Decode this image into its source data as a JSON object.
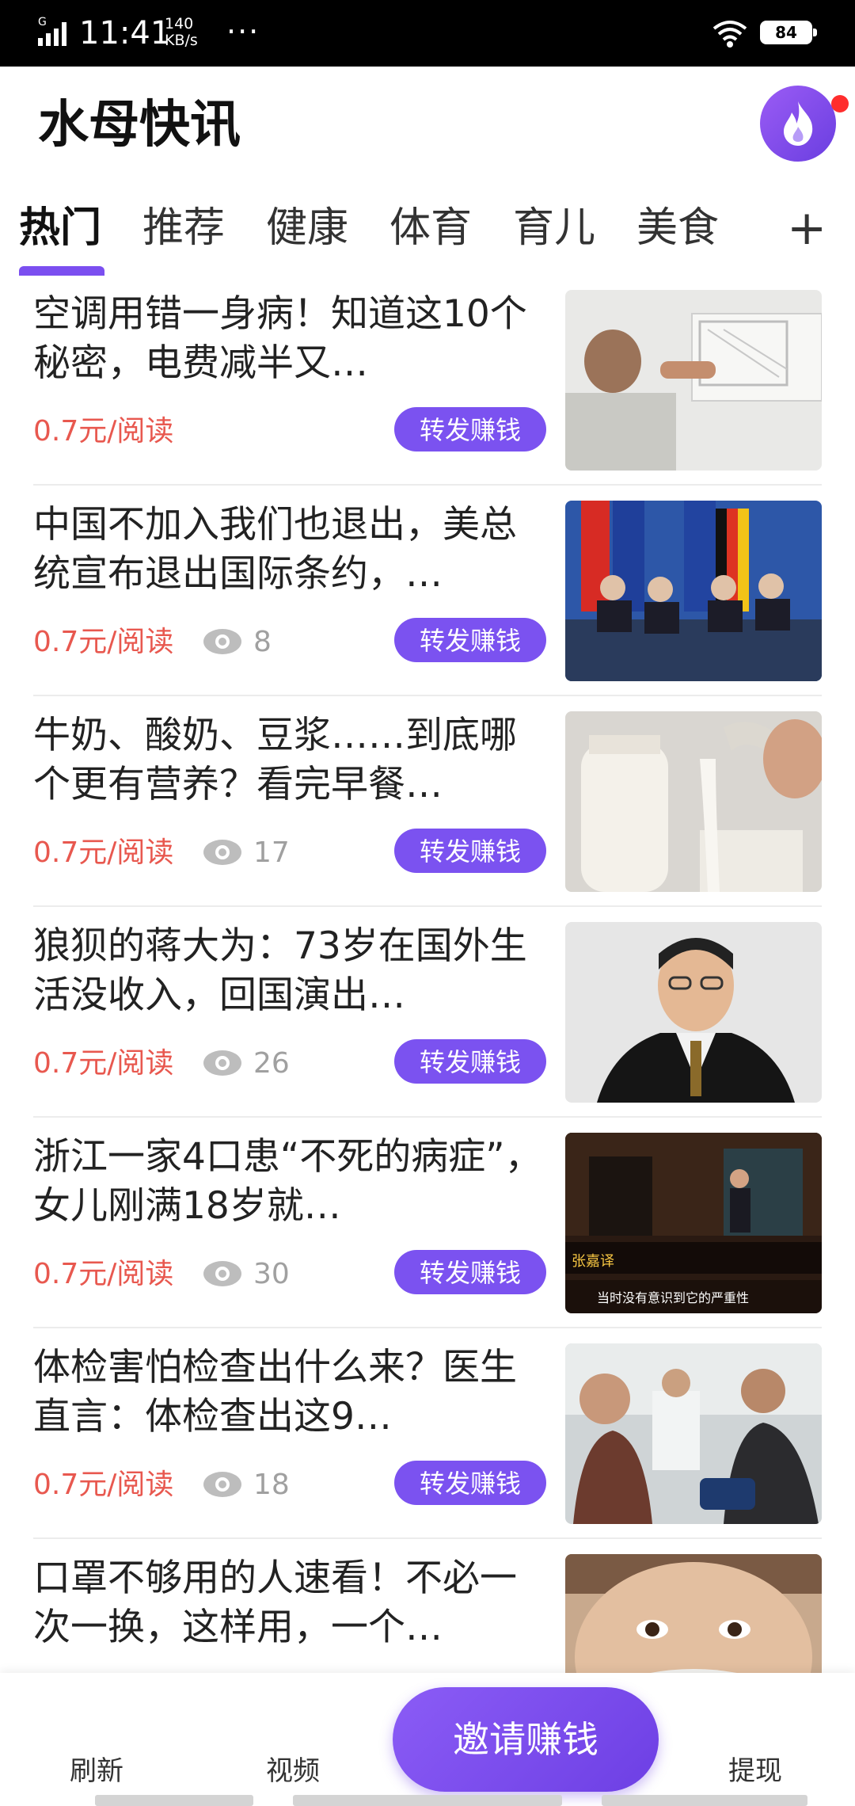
{
  "status_bar": {
    "time": "11:41",
    "net_speed_value": "140",
    "net_speed_unit": "KB/s",
    "dots": "···",
    "battery": "84"
  },
  "header": {
    "title": "水母快讯"
  },
  "tabs": [
    {
      "label": "热门"
    },
    {
      "label": "推荐"
    },
    {
      "label": "健康"
    },
    {
      "label": "体育"
    },
    {
      "label": "育儿"
    },
    {
      "label": "美食"
    }
  ],
  "tab_add_label": "+",
  "feed": [
    {
      "title": "空调用错一身病！知道这10个秘密，电费减半又…",
      "price": "0.7元/阅读",
      "views": "",
      "share": "转发赚钱",
      "thumb": "man-fixing-air-conditioner"
    },
    {
      "title": "中国不加入我们也退出，美总统宣布退出国际条约，…",
      "price": "0.7元/阅读",
      "views": "8",
      "share": "转发赚钱",
      "thumb": "treaty-signing-with-flags"
    },
    {
      "title": "牛奶、酸奶、豆浆……到底哪个更有营养？看完早餐…",
      "price": "0.7元/阅读",
      "views": "17",
      "share": "转发赚钱",
      "thumb": "pouring-milk"
    },
    {
      "title": "狼狈的蒋大为：73岁在国外生活没收入，回国演出…",
      "price": "0.7元/阅读",
      "views": "26",
      "share": "转发赚钱",
      "thumb": "man-portrait-suit"
    },
    {
      "title": "浙江一家4口患“不死的病症”，女儿刚满18岁就…",
      "price": "0.7元/阅读",
      "views": "30",
      "share": "转发赚钱",
      "thumb": "tv-show-stage",
      "thumb_caption_1": "张嘉译",
      "thumb_caption_2": "当时没有意识到它的严重性"
    },
    {
      "title": "体检害怕检查出什么来？医生直言：体检查出这9…",
      "price": "0.7元/阅读",
      "views": "18",
      "share": "转发赚钱",
      "thumb": "medical-checkup"
    },
    {
      "title": "口罩不够用的人速看！不必一次一换，这样用，一个…",
      "price": "",
      "views": "",
      "share": "",
      "thumb": "child-with-mask"
    }
  ],
  "bottom_nav": {
    "refresh": "刷新",
    "video": "视频",
    "invite": "邀请赚钱",
    "withdraw": "提现"
  },
  "colors": {
    "accent": "#7b52f0",
    "price": "#e8584f",
    "badge_dot": "#ff2d2d"
  }
}
